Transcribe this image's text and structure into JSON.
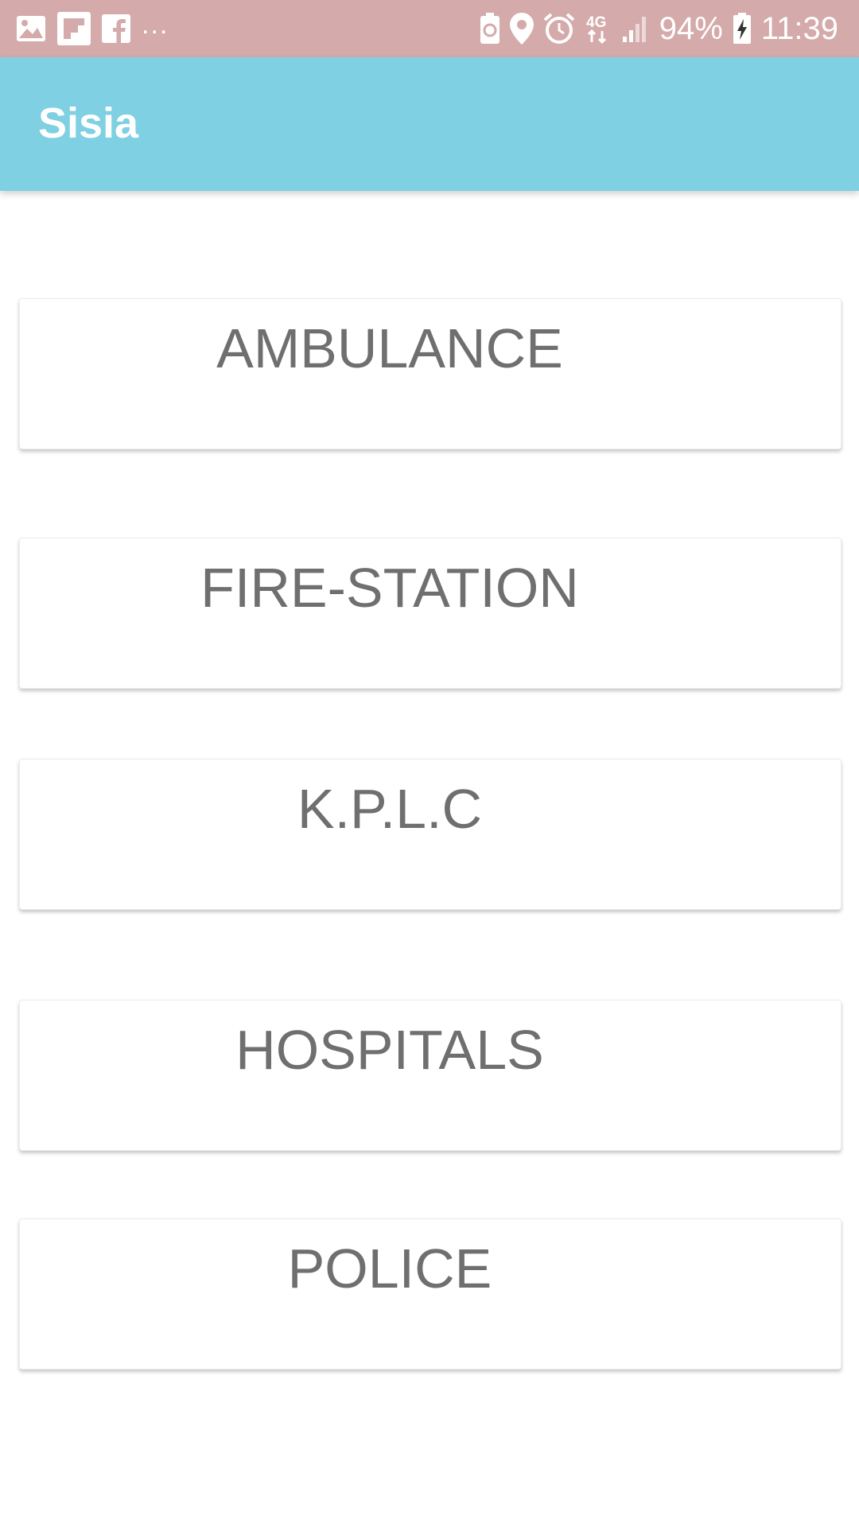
{
  "status_bar": {
    "left_icons": [
      "image-icon",
      "flipboard-icon",
      "facebook-icon"
    ],
    "overflow": "...",
    "right_icons": [
      "battery-saver-icon",
      "location-icon",
      "alarm-icon",
      "network-4g-icon",
      "signal-icon"
    ],
    "battery_percent": "94%",
    "time": "11:39"
  },
  "app_bar": {
    "title": "Sisia"
  },
  "services": [
    {
      "label": "AMBULANCE"
    },
    {
      "label": "FIRE-STATION"
    },
    {
      "label": "K.P.L.C"
    },
    {
      "label": "HOSPITALS"
    },
    {
      "label": "POLICE"
    }
  ],
  "colors": {
    "status_bar": "#d4aaaa",
    "app_bar": "#7fd0e3",
    "card_text": "#6f6f6f"
  }
}
